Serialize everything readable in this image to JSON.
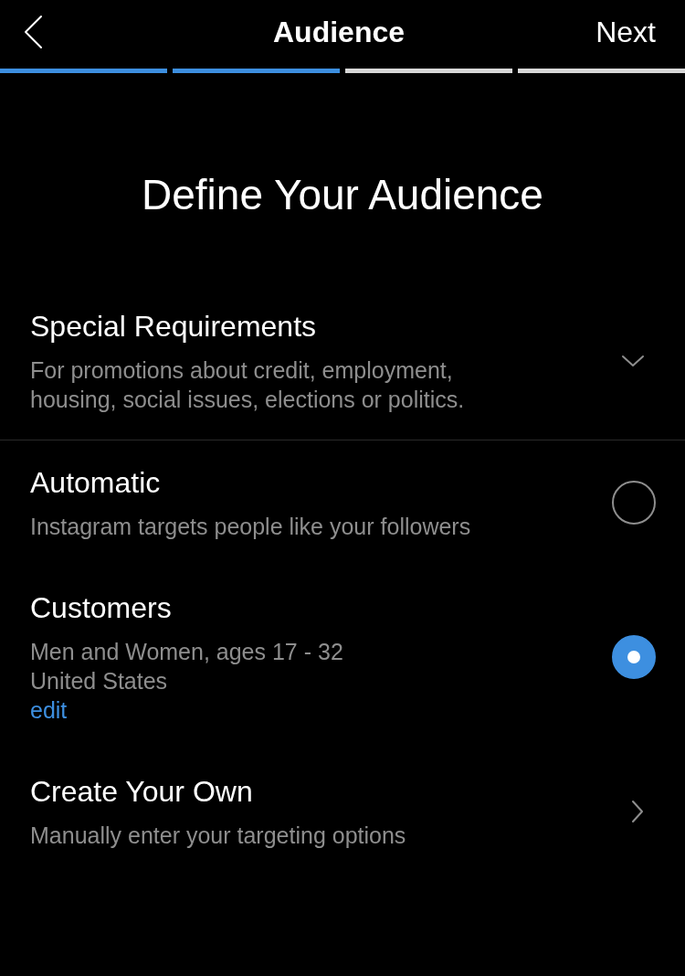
{
  "header": {
    "title": "Audience",
    "next": "Next"
  },
  "steps": [
    {
      "done": true
    },
    {
      "done": true
    },
    {
      "done": false
    },
    {
      "done": false
    }
  ],
  "heading": "Define Your Audience",
  "options": [
    {
      "kind": "dropdown",
      "title": "Special Requirements",
      "details": [
        "For promotions about credit, employment, housing, social issues, elections or politics."
      ],
      "divider": true
    },
    {
      "kind": "radio",
      "title": "Automatic",
      "details": [
        "Instagram targets people like your followers"
      ],
      "selected": false
    },
    {
      "kind": "radio",
      "title": "Customers",
      "details": [
        "Men and Women, ages 17 - 32",
        "United States"
      ],
      "link": "edit",
      "selected": true
    },
    {
      "kind": "link",
      "title": "Create Your Own",
      "details": [
        "Manually enter your targeting options"
      ]
    }
  ]
}
